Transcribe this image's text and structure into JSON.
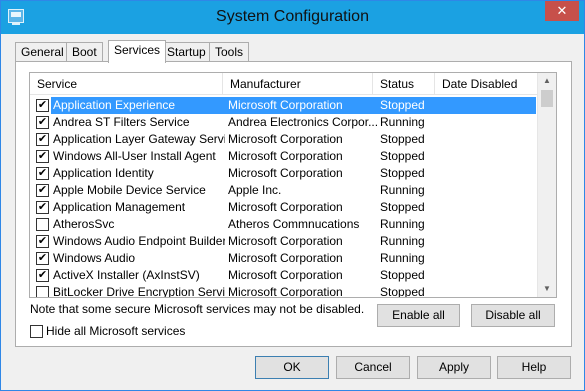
{
  "window": {
    "title": "System Configuration",
    "close_glyph": "✕"
  },
  "tabs": [
    {
      "label": "General"
    },
    {
      "label": "Boot"
    },
    {
      "label": "Services"
    },
    {
      "label": "Startup"
    },
    {
      "label": "Tools"
    }
  ],
  "active_tab": "Services",
  "columns": {
    "service": "Service",
    "manufacturer": "Manufacturer",
    "status": "Status",
    "date_disabled": "Date Disabled"
  },
  "services": [
    {
      "checked": true,
      "name": "Application Experience",
      "manufacturer": "Microsoft Corporation",
      "status": "Stopped",
      "date_disabled": ""
    },
    {
      "checked": true,
      "name": "Andrea ST Filters Service",
      "manufacturer": "Andrea Electronics Corpor...",
      "status": "Running",
      "date_disabled": ""
    },
    {
      "checked": true,
      "name": "Application Layer Gateway Service",
      "manufacturer": "Microsoft Corporation",
      "status": "Stopped",
      "date_disabled": ""
    },
    {
      "checked": true,
      "name": "Windows All-User Install Agent",
      "manufacturer": "Microsoft Corporation",
      "status": "Stopped",
      "date_disabled": ""
    },
    {
      "checked": true,
      "name": "Application Identity",
      "manufacturer": "Microsoft Corporation",
      "status": "Stopped",
      "date_disabled": ""
    },
    {
      "checked": true,
      "name": "Apple Mobile Device Service",
      "manufacturer": "Apple Inc.",
      "status": "Running",
      "date_disabled": ""
    },
    {
      "checked": true,
      "name": "Application Management",
      "manufacturer": "Microsoft Corporation",
      "status": "Stopped",
      "date_disabled": ""
    },
    {
      "checked": false,
      "name": "AtherosSvc",
      "manufacturer": "Atheros Commnucations",
      "status": "Running",
      "date_disabled": ""
    },
    {
      "checked": true,
      "name": "Windows Audio Endpoint Builder",
      "manufacturer": "Microsoft Corporation",
      "status": "Running",
      "date_disabled": ""
    },
    {
      "checked": true,
      "name": "Windows Audio",
      "manufacturer": "Microsoft Corporation",
      "status": "Running",
      "date_disabled": ""
    },
    {
      "checked": true,
      "name": "ActiveX Installer (AxInstSV)",
      "manufacturer": "Microsoft Corporation",
      "status": "Stopped",
      "date_disabled": ""
    },
    {
      "checked": false,
      "name": "BitLocker Drive Encryption Service",
      "manufacturer": "Microsoft Corporation",
      "status": "Stopped",
      "date_disabled": ""
    }
  ],
  "selected_index": 0,
  "note": "Note that some secure Microsoft services may not be disabled.",
  "buttons": {
    "enable_all": "Enable all",
    "disable_all": "Disable all",
    "ok": "OK",
    "cancel": "Cancel",
    "apply": "Apply",
    "help": "Help"
  },
  "hide_ms": {
    "label": "Hide all Microsoft services",
    "checked": false
  },
  "check_glyph": "✔",
  "scroll_up_glyph": "▲",
  "scroll_down_glyph": "▼",
  "colors": {
    "titlebar": "#1ba1e2",
    "selection": "#3399ff",
    "close": "#c7504a"
  }
}
